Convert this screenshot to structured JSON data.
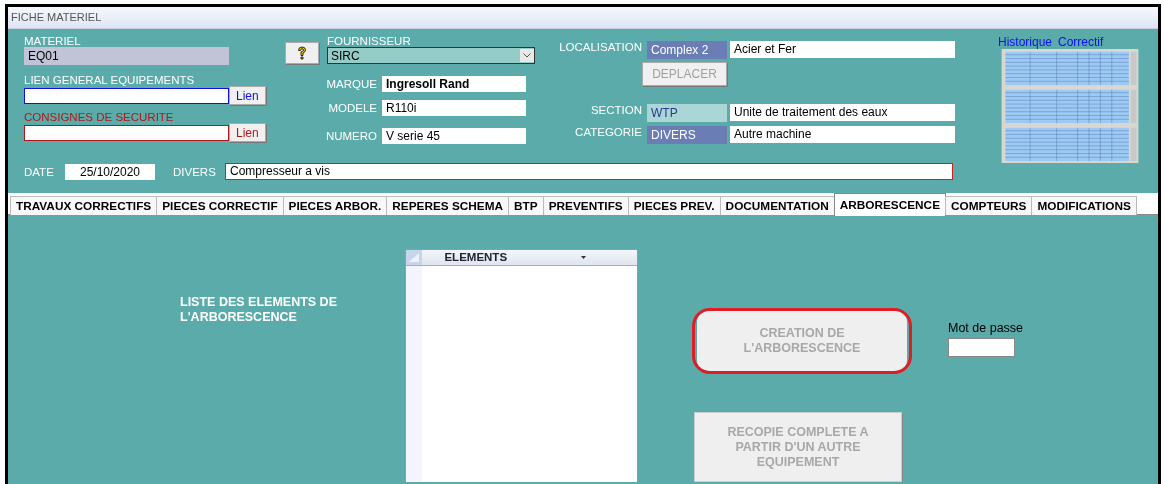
{
  "window": {
    "title": "FICHE MATERIEL"
  },
  "header": {
    "materiel": {
      "label": "MATERIEL",
      "value": "EQ01"
    },
    "links": [
      {
        "label": "LIEN GENERAL EQUIPEMENTS",
        "button": "Lien",
        "color": "#1010e0"
      },
      {
        "label": "CONSIGNES DE SECURITE",
        "button": "Lien",
        "color": "#b01818"
      }
    ],
    "fournisseur": {
      "label": "FOURNISSEUR",
      "value": "SIRC"
    },
    "fields": [
      {
        "label": "MARQUE",
        "value": "Ingresoll Rand",
        "emphasis": true
      },
      {
        "label": "MODELE",
        "value": "R110i",
        "emphasis": false
      },
      {
        "label": "NUMERO",
        "value": "V serie 45",
        "emphasis": false
      }
    ],
    "locations": [
      {
        "label": "LOCALISATION",
        "code": "Complex 2",
        "name": "Acier et Fer",
        "color": "#6a7db4"
      },
      {
        "label": "SECTION",
        "code": "WTP",
        "name": "Unite de traitement des eaux",
        "color": "#abd6d6"
      },
      {
        "label": "CATEGORIE",
        "code": "DIVERS",
        "name": "Autre machine",
        "color": "#6a7db4"
      }
    ],
    "move_button": {
      "label": "DEPLACER",
      "disabled": true
    },
    "history_links": [
      "Historique",
      "Correctif"
    ],
    "date": {
      "label": "DATE",
      "value": "25/10/2020"
    },
    "divers": {
      "label": "DIVERS",
      "value": "Compresseur a vis"
    }
  },
  "tabs": [
    {
      "label": "TRAVAUX CORRECTIFS",
      "selected": false
    },
    {
      "label": "PIECES CORRECTIF",
      "selected": false
    },
    {
      "label": "PIECES ARBOR.",
      "selected": false
    },
    {
      "label": "REPERES SCHEMA",
      "selected": false
    },
    {
      "label": "BTP",
      "selected": false
    },
    {
      "label": "PREVENTIFS",
      "selected": false
    },
    {
      "label": "PIECES PREV.",
      "selected": false
    },
    {
      "label": "DOCUMENTATION",
      "selected": false
    },
    {
      "label": "ARBORESCENCE",
      "selected": true
    },
    {
      "label": "COMPTEURS",
      "selected": false
    },
    {
      "label": "MODIFICATIONS",
      "selected": false
    }
  ],
  "arborescence": {
    "title": "LISTE DES ELEMENTS DE L'ARBORESCENCE",
    "list_header": "ELEMENTS",
    "create_button": {
      "label": "CREATION DE L'ARBORESCENCE",
      "disabled": true,
      "highlighted": true
    },
    "password": {
      "label": "Mot de passe"
    },
    "copy_button": {
      "label": "RECOPIE COMPLETE A PARTIR D'UN AUTRE EQUIPEMENT",
      "disabled": true
    }
  }
}
